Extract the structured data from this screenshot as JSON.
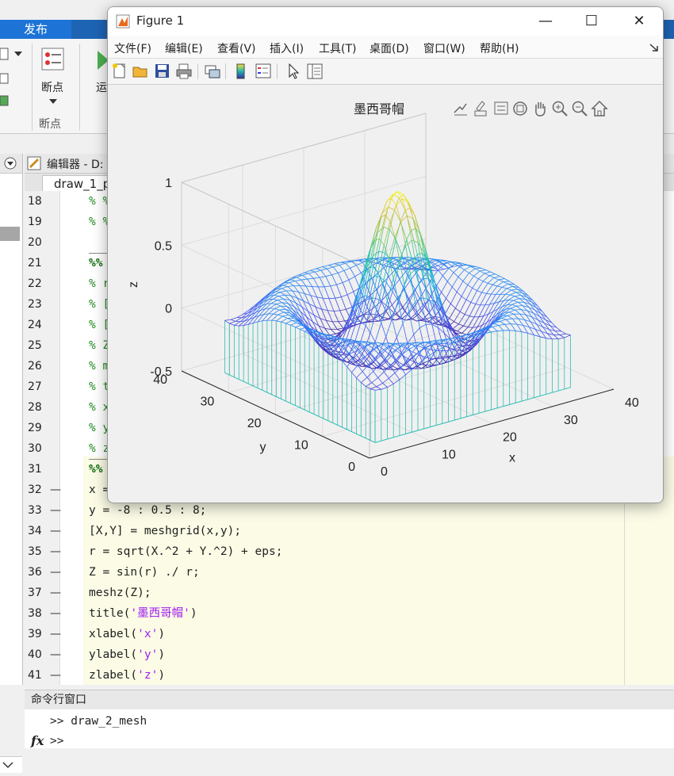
{
  "ribbon": {
    "tab_publish": "发布",
    "breakpoints_label": "断点",
    "breakpoints_group": "断点",
    "run_label": "运"
  },
  "editor": {
    "header": "编辑器 - D:",
    "file_tab": "draw_1_p",
    "lines": [
      {
        "n": "18",
        "dash": "",
        "text": "% %",
        "kind": "comment"
      },
      {
        "n": "19",
        "dash": "",
        "text": "% %",
        "kind": "comment"
      },
      {
        "n": "20",
        "dash": "",
        "text": "",
        "kind": "code"
      },
      {
        "n": "21",
        "dash": "",
        "text": "%%",
        "kind": "cell"
      },
      {
        "n": "22",
        "dash": "",
        "text": "% r",
        "kind": "comment"
      },
      {
        "n": "23",
        "dash": "",
        "text": "% [",
        "kind": "comment"
      },
      {
        "n": "24",
        "dash": "",
        "text": "% [",
        "kind": "comment"
      },
      {
        "n": "25",
        "dash": "",
        "text": "% Z",
        "kind": "comment"
      },
      {
        "n": "26",
        "dash": "",
        "text": "% m",
        "kind": "comment"
      },
      {
        "n": "27",
        "dash": "",
        "text": "% t",
        "kind": "comment"
      },
      {
        "n": "28",
        "dash": "",
        "text": "% x",
        "kind": "comment"
      },
      {
        "n": "29",
        "dash": "",
        "text": "% y",
        "kind": "comment"
      },
      {
        "n": "30",
        "dash": "",
        "text": "% z",
        "kind": "comment"
      },
      {
        "n": "31",
        "dash": "",
        "text": "%%",
        "kind": "cell"
      },
      {
        "n": "32",
        "dash": "—",
        "text": "x =",
        "kind": "code"
      },
      {
        "n": "33",
        "dash": "—",
        "text": "y = -8 : 0.5 : 8;",
        "kind": "code"
      },
      {
        "n": "34",
        "dash": "—",
        "text": "[X,Y] = meshgrid(x,y);",
        "kind": "code"
      },
      {
        "n": "35",
        "dash": "—",
        "text": "r = sqrt(X.^2 + Y.^2) + eps;",
        "kind": "code"
      },
      {
        "n": "36",
        "dash": "—",
        "text": "Z = sin(r) ./ r;",
        "kind": "code"
      },
      {
        "n": "37",
        "dash": "—",
        "text": "meshz(Z);",
        "kind": "code"
      },
      {
        "n": "38",
        "dash": "—",
        "text": "title('墨西哥帽')",
        "kind": "fn",
        "fn": "title(",
        "str": "'墨西哥帽'",
        "end": ")"
      },
      {
        "n": "39",
        "dash": "—",
        "text": "xlabel('x')",
        "kind": "fn",
        "fn": "xlabel(",
        "str": "'x'",
        "end": ")"
      },
      {
        "n": "40",
        "dash": "—",
        "text": "ylabel('y')",
        "kind": "fn",
        "fn": "ylabel(",
        "str": "'y'",
        "end": ")"
      },
      {
        "n": "41",
        "dash": "—",
        "text": "zlabel('z')",
        "kind": "fn",
        "fn": "zlabel(",
        "str": "'z'",
        "end": ")"
      }
    ]
  },
  "command_window": {
    "header": "命令行窗口",
    "line1": ">> draw_2_mesh",
    "prompt": ">>",
    "fx": "fx"
  },
  "figure": {
    "title": "Figure 1",
    "menu": [
      "文件(F)",
      "编辑(E)",
      "查看(V)",
      "插入(I)",
      "工具(T)",
      "桌面(D)",
      "窗口(W)",
      "帮助(H)"
    ],
    "window_buttons": {
      "minimize": "—",
      "maximize": "☐",
      "close": "✕"
    },
    "toolbar_icons": [
      "new-figure-icon",
      "open-file-icon",
      "save-icon",
      "print-icon",
      "link-plot-icon",
      "colorbar-icon",
      "legend-icon",
      "edit-plot-icon",
      "property-inspector-icon"
    ],
    "axes_toolbar_icons": [
      "export-icon",
      "brush-icon",
      "data-tips-icon",
      "rotate-icon",
      "pan-icon",
      "zoom-in-icon",
      "zoom-out-icon",
      "home-icon"
    ]
  },
  "chart_data": {
    "type": "mesh",
    "title": "墨西哥帽",
    "xlabel": "x",
    "ylabel": "y",
    "zlabel": "z",
    "function": "Z = sin(r)./r, r = sqrt(X.^2+Y.^2)+eps, x,y from -8 to 8 step 0.5",
    "xlim": [
      0,
      40
    ],
    "ylim": [
      0,
      40
    ],
    "zlim": [
      -0.5,
      1
    ],
    "xticks": [
      "0",
      "10",
      "20",
      "30",
      "40"
    ],
    "yticks": [
      "0",
      "10",
      "20",
      "30",
      "40"
    ],
    "zticks": [
      "-0.5",
      "0",
      "0.5",
      "1"
    ],
    "peak_value": 1,
    "grid": true,
    "colormap": "parula"
  }
}
